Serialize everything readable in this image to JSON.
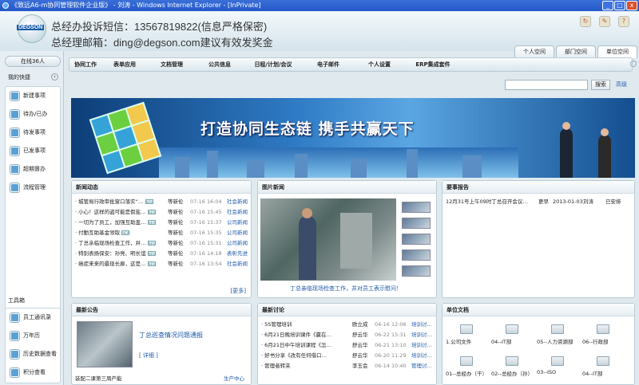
{
  "window": {
    "title": "《致远A6-m协同管理软件企业版》 - 刘涛 - Windows Internet Explorer - [InPrivate]",
    "controls": [
      "_",
      "□",
      "x"
    ]
  },
  "header": {
    "logo_text": "DEGSON",
    "line1": "总经办投诉短信：13567819822(信息严格保密)",
    "line2": "总经理邮箱：ding@degson.com建议有效发奖金",
    "icons": [
      "refresh-icon",
      "edit-icon",
      "help-icon"
    ],
    "icon_glyphs": [
      "↻",
      "✎",
      "?"
    ],
    "tabs": [
      "个人空间",
      "部门空间",
      "单位空间"
    ],
    "active_tab": 2
  },
  "sidebar": {
    "online": "在线36人",
    "shortcuts_title": "我的快捷",
    "collapse": "‹",
    "items": [
      "新建事项",
      "待办/已办",
      "待发事项",
      "已发事项",
      "超期督办",
      "流程管理"
    ],
    "tools_title": "工具箱",
    "tools": [
      "员工通讯录",
      "万年历",
      "历史数据查看",
      "积分查看"
    ]
  },
  "nav": {
    "items": [
      "协同工作",
      "表单应用",
      "文档管理",
      "公共信息",
      "日程/计划/会议",
      "电子邮件",
      "个人设置",
      "ERP集成套件"
    ]
  },
  "search": {
    "placeholder": "",
    "button": "搜索",
    "advanced": "高级"
  },
  "banner": {
    "slogan": "打造协同生态链  携手共赢天下"
  },
  "news": {
    "title": "新闻动态",
    "more": "[更多]",
    "rows": [
      {
        "title": "城管局行政审批窗口落实“…",
        "author": "等新伦",
        "date": "07-16 16:04",
        "category": "社会新闻"
      },
      {
        "title": "小心！这样的盗可能是假盐…",
        "author": "等新伦",
        "date": "07-16 15:45",
        "category": "社会新闻"
      },
      {
        "title": "一切为了员工，加强互助盖…",
        "author": "等新伦",
        "date": "07-16 15:37",
        "category": "公司新闻"
      },
      {
        "title": "付勤互助基金领取",
        "author": "等新伦",
        "date": "07-16 15:35",
        "category": "公司新闻"
      },
      {
        "title": "丁总亲临现场检查工作，并…",
        "author": "等新伦",
        "date": "07-16 15:31",
        "category": "公司新闻"
      },
      {
        "title": "特别表扬保安：孙亮、明长谊",
        "author": "等新伦",
        "date": "07-16 14:18",
        "category": "表彰先进"
      },
      {
        "title": "癌症来来的最现长廊，这是…",
        "author": "等新伦",
        "date": "07-16 13:54",
        "category": "社会新闻"
      }
    ]
  },
  "photo_news": {
    "title": "图片新闻",
    "caption": "丁总亲临现场检查工作，并对员工表示慰问！"
  },
  "reports": {
    "title": "要事报告",
    "rows": [
      {
        "title": "12月31号上午09时丁总召开会议…",
        "status": "更早",
        "date": "2013-01-03",
        "author": "刘涛",
        "state": "已安排"
      }
    ]
  },
  "notices": {
    "title": "最新公告",
    "feature_title": "丁总巡查情况问题通报",
    "detail": "[ 详细 ]",
    "rows": [
      {
        "title": "装配二课第三周产能",
        "category": "生产中心"
      }
    ]
  },
  "discussions": {
    "title": "最新讨论",
    "rows": [
      {
        "title": "5S管理培训",
        "author": "欧立成",
        "date": "04-16 12:06",
        "category": "培训讨…"
      },
      {
        "title": "6月21日晚培训课件《赢在…",
        "author": "舒云华",
        "date": "06-22 15:31",
        "category": "培训讨…"
      },
      {
        "title": "6月21日中午培训课程《怎…",
        "author": "舒云华",
        "date": "06-21 13:10",
        "category": "培训讨…"
      },
      {
        "title": "好书分享《改有任何借口…",
        "author": "舒云华",
        "date": "06-20 11:29",
        "category": "培训讨…"
      },
      {
        "title": "管理者转夹",
        "author": "李玉会",
        "date": "06-14 10:40",
        "category": "管理讨…"
      }
    ]
  },
  "docs": {
    "title": "单位文档",
    "folders": [
      "1.公司文件",
      "04--IT部",
      "05--人力资源部",
      "06--行政部",
      "01--总经办（干）",
      "02--总经办（孙）",
      "03--ISO",
      "04--IT部"
    ]
  }
}
